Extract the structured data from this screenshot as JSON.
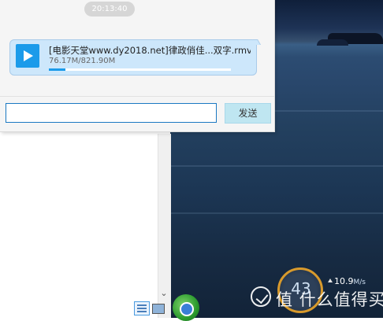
{
  "chat": {
    "timestamp": "20:13:40",
    "file_message": {
      "file_name": "[电影天堂www.dy2018.net]律政俏佳...双字.rmvb",
      "file_size": "76.17M/821.90M",
      "progress": 0.093,
      "icon": "play-icon"
    },
    "input": {
      "value": "",
      "placeholder": ""
    },
    "send_label": "发送"
  },
  "taskbar": {
    "icons": [
      "view-list-icon",
      "view-image-icon",
      "download-icon"
    ]
  },
  "speed_widget": {
    "percent": "43",
    "upload_speed": "10.9",
    "unit": "M/s",
    "ring_color": "#d89a2c"
  },
  "watermark": {
    "text": "值 什么值得买"
  },
  "colors": {
    "accent": "#1b9bea",
    "bubble": "#cde7fb",
    "send_button": "#bfe6f1"
  }
}
